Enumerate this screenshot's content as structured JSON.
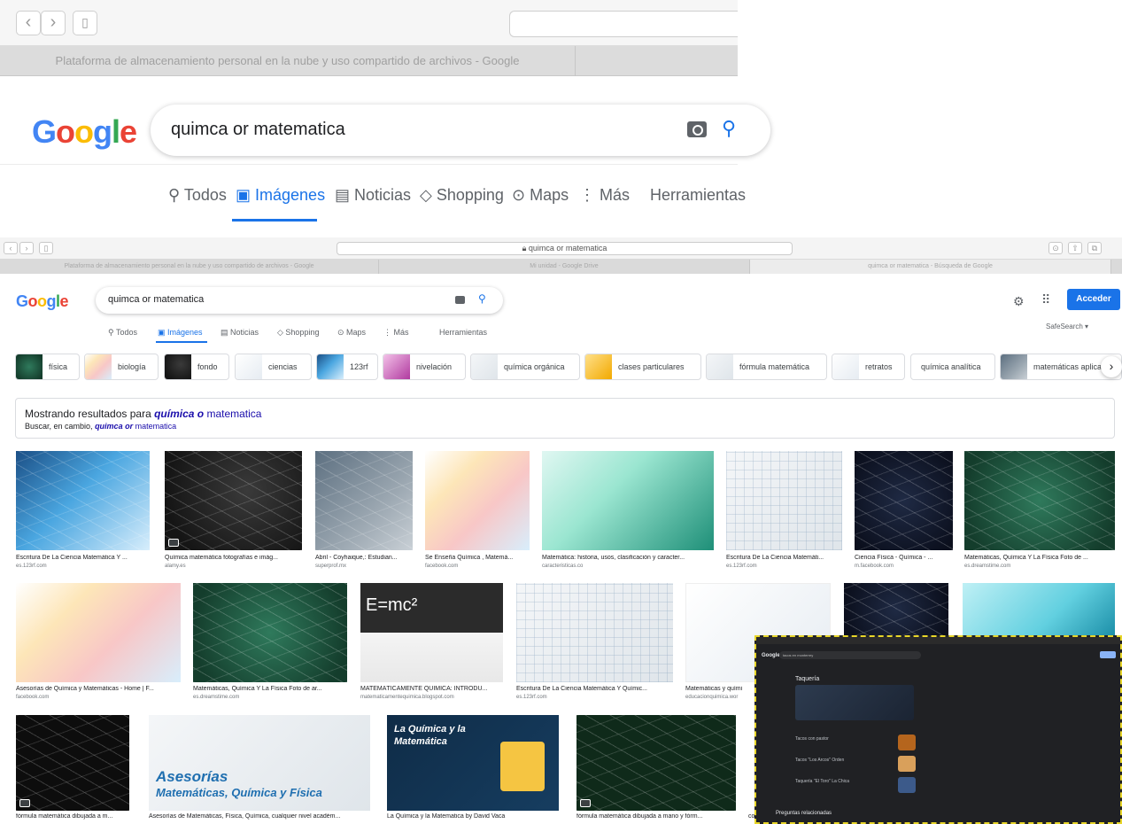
{
  "zoom": {
    "tab_left": "Plataforma de almacenamiento personal en la nube y uso compartido de archivos - Google",
    "logo_letters": [
      "G",
      "o",
      "o",
      "g",
      "l",
      "e"
    ],
    "search_value": "quimca or matematica",
    "nav": {
      "todos": "Todos",
      "imagenes": "Imágenes",
      "noticias": "Noticias",
      "shopping": "Shopping",
      "maps": "Maps",
      "mas": "Más",
      "herramientas": "Herramientas"
    }
  },
  "full": {
    "url": "quimca or matematica",
    "tabs": [
      "Plataforma de almacenamiento personal en la nube y uso compartido de archivos - Google",
      "Mi unidad - Google Drive",
      "quimca or matematica - Búsqueda de Google"
    ],
    "search_value": "quimca or matematica",
    "acceder": "Acceder",
    "safesearch": "SafeSearch ▾",
    "nav": {
      "todos": "Todos",
      "imagenes": "Imágenes",
      "noticias": "Noticias",
      "shopping": "Shopping",
      "maps": "Maps",
      "mas": "Más",
      "herramientas": "Herramientas"
    },
    "chips": [
      "física",
      "biología",
      "fondo",
      "ciencias",
      "123rf",
      "nivelación",
      "química orgánica",
      "clases particulares",
      "fórmula matemática",
      "retratos",
      "química analítica",
      "matemáticas aplicadas"
    ],
    "showing": {
      "prefix": "Mostrando resultados para",
      "term_bold": "química o",
      "term_rest": "matematica",
      "alt_prefix": "Buscar, en cambio,",
      "alt_bold": "quimca or",
      "alt_rest": "matematica"
    },
    "results": [
      {
        "cap": "Escritura De La Ciencia Matemática Y ...",
        "src": "es.123rf.com"
      },
      {
        "cap": "Química matemática fotografías e imág...",
        "src": "alamy.es"
      },
      {
        "cap": "Abril - Coyhaique,: Estudian...",
        "src": "superprof.mx"
      },
      {
        "cap": "Se Enseña Química , Matemá...",
        "src": "facebook.com"
      },
      {
        "cap": "Matemática: historia, usos, clasificación y caracter...",
        "src": "caracteristicas.co"
      },
      {
        "cap": "Escritura De La Ciencia Matemáti...",
        "src": "es.123rf.com"
      },
      {
        "cap": "Ciencia Física - Química - ...",
        "src": "m.facebook.com"
      },
      {
        "cap": "Matemáticas, Química Y La Física Foto de ...",
        "src": "es.dreamstime.com"
      },
      {
        "cap": "Asesorías de Química y Matemáticas - Home | F...",
        "src": "facebook.com"
      },
      {
        "cap": "Matemáticas, Química Y La Física Foto de ar...",
        "src": "es.dreamstime.com"
      },
      {
        "cap": "MATEMÁTICAMENTE QUÍMICA: INTRODU...",
        "src": "matematicamentequimica.blogspot.com"
      },
      {
        "cap": "Escritura De La Ciencia Matemática Y Químic...",
        "src": "es.123rf.com"
      },
      {
        "cap": "Matemáticas y quími",
        "src": "educacionquimica.wor"
      },
      {
        "cap": "fórmula matemática dibujada a m...",
        "src": ""
      },
      {
        "cap": "Asesorías de Matemáticas, Física, Química, cualquier nivel académ...",
        "src": ""
      },
      {
        "cap": "La Química y la Matematica by David Vaca",
        "src": ""
      },
      {
        "cap": "fórmula matemática dibujada a mano y fórm...",
        "src": ""
      },
      {
        "cap": "co",
        "src": ""
      }
    ],
    "box_text": {
      "asesorias": "Asesorías",
      "asesorias_sub": "Matemáticas, Química y Física",
      "quimica_mat_1": "La Química y la",
      "quimica_mat_2": "Matemática",
      "emc2": "E=mc²"
    },
    "overlay": {
      "search": "tacos en monterrey",
      "heading": "Taquería",
      "lbl1": "Tacos con pastor",
      "lbl2": "Tacos \"Los Arcos\" Orden",
      "lbl3": "Taquería \"El Toro\" La Chica",
      "lbl4": "Preguntas relacionadas"
    }
  },
  "colors": {
    "blue": "#4285F4",
    "red": "#EA4335",
    "yellow": "#FBBC05",
    "green": "#34A853",
    "accent": "#1a73e8",
    "link": "#1a0dab"
  }
}
